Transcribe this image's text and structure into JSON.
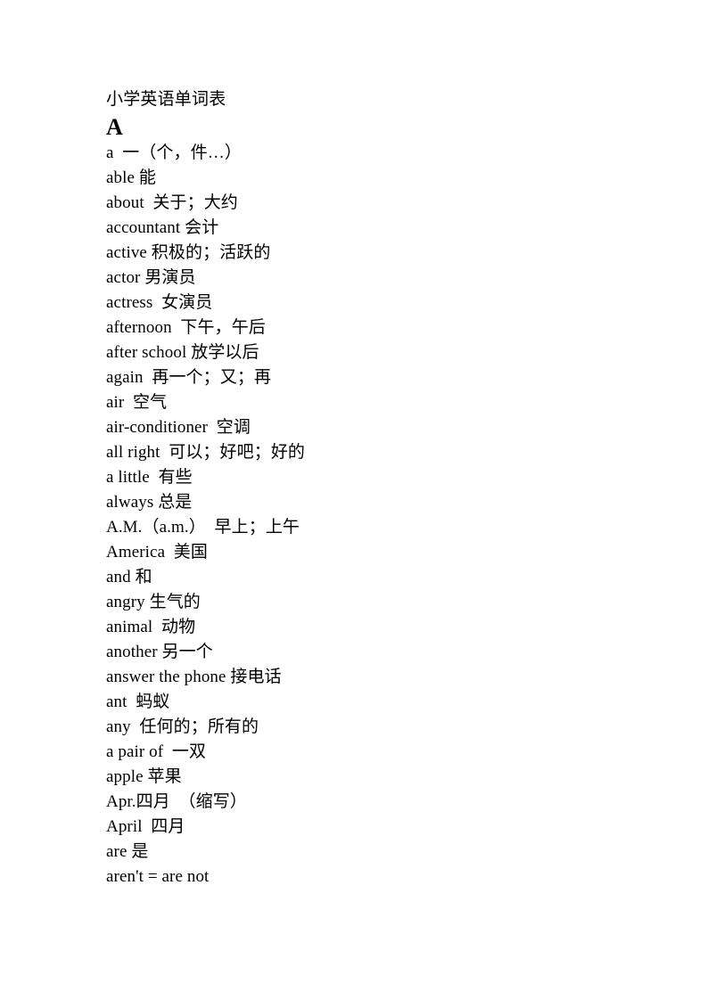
{
  "document": {
    "title": "小学英语单词表",
    "section_letter": "A",
    "entries": [
      "a  一（个，件…）",
      "able 能",
      "about  关于；大约",
      "accountant 会计",
      "active 积极的；活跃的",
      "actor 男演员",
      "actress  女演员",
      "afternoon  下午，午后",
      "after school 放学以后",
      "again  再一个；又；再",
      "air  空气",
      "air-conditioner  空调",
      "all right  可以；好吧；好的",
      "a little  有些",
      "always 总是",
      "A.M.（a.m.）  早上；上午",
      "America  美国",
      "and 和",
      "angry 生气的",
      "animal  动物",
      "another 另一个",
      "answer the phone 接电话",
      "ant  蚂蚁",
      "any  任何的；所有的",
      "a pair of  一双",
      "apple 苹果",
      "Apr.四月  （缩写）",
      "April  四月",
      "are 是",
      "aren't = are not"
    ]
  }
}
